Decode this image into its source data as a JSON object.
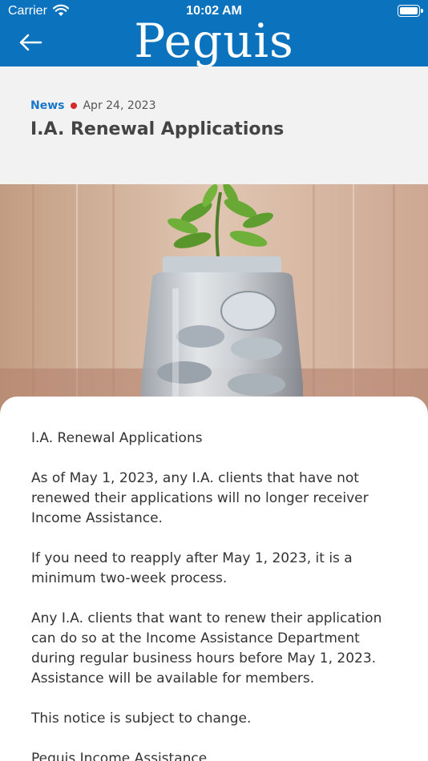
{
  "status_bar": {
    "carrier": "Carrier",
    "time": "10:02 AM"
  },
  "header": {
    "brand": "Peguis"
  },
  "article": {
    "category": "News",
    "date": "Apr 24, 2023",
    "title": "I.A. Renewal Applications",
    "paragraphs": [
      "I.A. Renewal Applications",
      "As of May 1, 2023, any I.A. clients that have not renewed their applications will no longer receiver Income Assistance.",
      "If you need to reapply after May 1, 2023, it is a minimum two-week process.",
      "Any I.A. clients that want to renew their application can do so at the Income Assistance Department during regular business hours before May 1, 2023. Assistance will be available for members.",
      "This notice is subject to change.",
      "Peguis Income Assistance"
    ]
  },
  "colors": {
    "brand_blue": "#0b72bd",
    "category_blue": "#1976c8",
    "dot_red": "#d52a2a"
  }
}
